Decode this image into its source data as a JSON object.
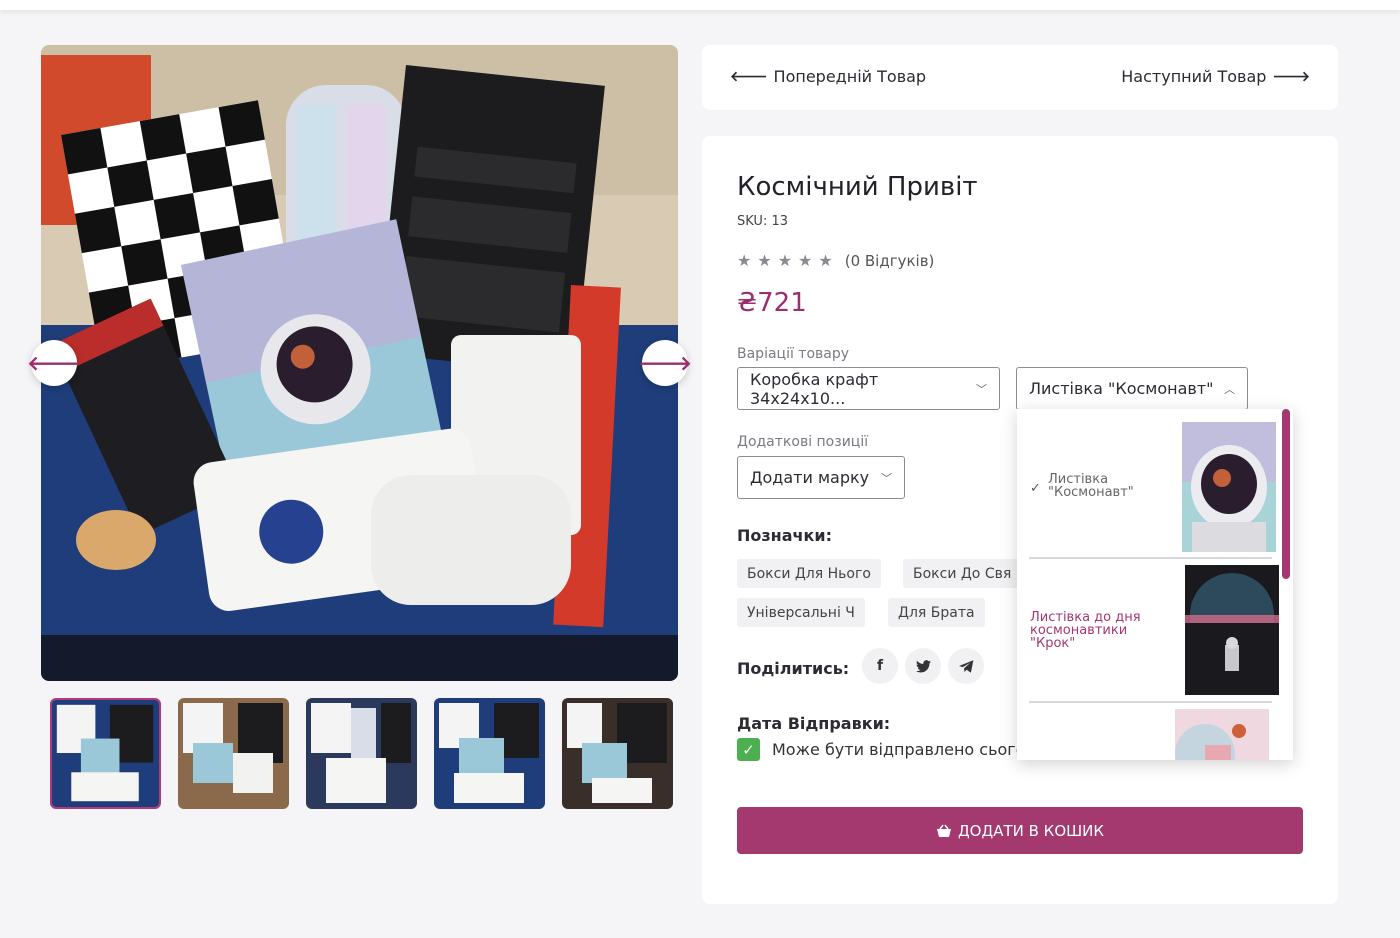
{
  "navigation": {
    "prev_label": "Попередній Товар",
    "next_label": "Наступний Товар"
  },
  "product": {
    "title": "Космічний Привіт",
    "sku": "SKU: 13",
    "rating": 0,
    "reviews_label": "(0 Відгуків)",
    "price": "₴721"
  },
  "variations": {
    "label": "Варіації товару",
    "box_value": "Коробка крафт 34х24х10...",
    "card_value": "Листівка \"Космонавт\""
  },
  "additional": {
    "label": "Додаткові позиції",
    "value": "Додати марку"
  },
  "tags": {
    "label": "Позначки:",
    "items": [
      "Бокси Для Нього",
      "Бокси До Свя",
      "Універсальні Ч",
      "Для Брата"
    ]
  },
  "share": {
    "label": "Поділитись:",
    "icons": [
      "facebook-icon",
      "twitter-icon",
      "telegram-icon"
    ]
  },
  "shipping": {
    "label": "Дата Відправки:",
    "note": "Може бути відправлено сього",
    "checked": true
  },
  "cart": {
    "button_label": "ДОДАТИ В КОШИК"
  },
  "dropdown": {
    "options": [
      {
        "label_line1": "Листівка",
        "label_line2": "\"Космонавт\"",
        "selected": true
      },
      {
        "label_line1": "Листівка до дня",
        "label_line2": "космонавтики",
        "label_line3": "\"Крок\"",
        "selected": false
      }
    ]
  },
  "colors": {
    "accent": "#a3396f",
    "price": "#9b2f6b",
    "check": "#4caf50",
    "background": "#f5f5f8"
  }
}
